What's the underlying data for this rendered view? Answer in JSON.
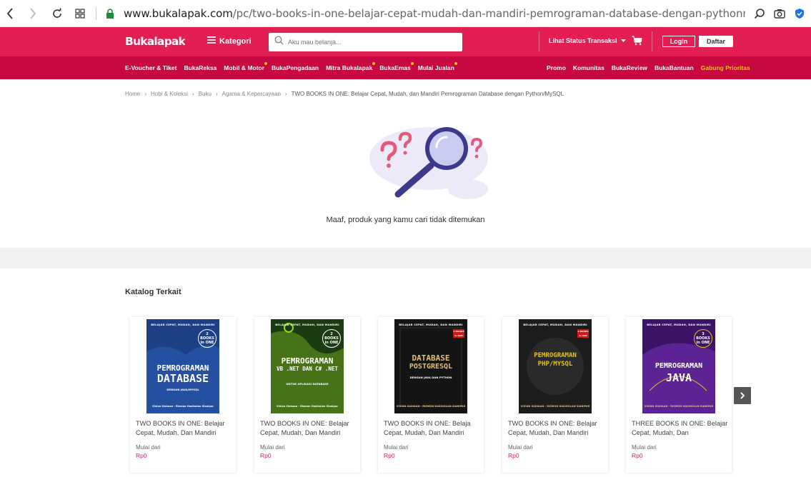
{
  "browser": {
    "url_host": "www.bukalapak.com",
    "url_path": "/pc/two-books-in-one-belajar-cepat-mudah-dan-mandiri-pemrograman-database-dengan-pythonmysql-vivian-siahaan"
  },
  "header": {
    "logo": "BUKALAPAK",
    "kategori_label": "Kategori",
    "search_placeholder": "Aku mau belanja...",
    "status_transaksi": "Lihat Status Transaksi",
    "login_label": "Login",
    "daftar_label": "Daftar"
  },
  "subnav_left": [
    {
      "label": "E-Voucher & Tiket",
      "dot": false
    },
    {
      "label": "BukaReksa",
      "dot": false
    },
    {
      "label": "Mobil & Motor",
      "dot": true
    },
    {
      "label": "BukaPengadaan",
      "dot": false
    },
    {
      "label": "Mitra Bukalapak",
      "dot": true
    },
    {
      "label": "BukaEmas",
      "dot": true
    },
    {
      "label": "Mulai Jualan",
      "dot": true
    }
  ],
  "subnav_right": [
    "Promo",
    "Komunitas",
    "BukaReview",
    "BukaBantuan",
    "Gabung Prioritas"
  ],
  "breadcrumb": [
    "Home",
    "Hobi & Koleksi",
    "Buku",
    "Agama & Kepercayaan",
    "TWO BOOKS IN ONE: Belajar Cepat, Mudah, dan Mandiri Pemrograman Database dengan Python/MySQL"
  ],
  "breadcrumb_sep": "›",
  "not_found_message": "Maaf, produk yang kamu cari tidak ditemukan",
  "katalog": {
    "title": "Katalog Terkait",
    "mulai_dari": "Mulai dari",
    "items": [
      {
        "name": "TWO BOOKS IN ONE: Belajar Cepat, Mudah, Dan Mandiri",
        "price": "Rp0",
        "cover": {
          "top": "BELAJAR CEPAT, MUDAH, DAN MANDIRI",
          "badge": "2 BOOKS in ONE",
          "title1": "PEMROGRAMAN",
          "title2": "DATABASE",
          "sub": "DENGAN JAVA/MYSQL",
          "author": "Vivian Siahaan - Rismon Hasiholan Sianipar",
          "bg": "#1d3f86"
        }
      },
      {
        "name": "TWO BOOKS IN ONE: Belajar Cepat, Mudah, Dan Mandiri",
        "price": "Rp0",
        "cover": {
          "top": "BELAJAR CEPAT, MUDAH, DAN MANDIRI",
          "badge": "2 BOOKS in ONE",
          "title1": "PEMROGRAMAN",
          "title2": "VB .NET DAN C# .NET",
          "sub": "UNTUK APLIKASI DATABASE",
          "author": "Vivian Siahaan - Rismon Hasiholan Sianipar",
          "bg": "#1f4a17"
        }
      },
      {
        "name": "TWO BOOKS IN ONE: Belaja Cepat, Mudah, Dan Mandiri",
        "price": "Rp0",
        "cover": {
          "top": "BELAJAR CEPAT, MUDAH, DAN MANDIRI",
          "badge": "2 BOOKS in ONE",
          "title1": "DATABASE",
          "title2": "POSTGRESQL",
          "sub": "DENGAN JAVA DAN PYTHON",
          "author": "VIVIAN SIAHAAN - RISMON HASIHOLAN SIANIPAR",
          "bg": "#151515"
        }
      },
      {
        "name": "TWO BOOKS IN ONE: Belajar Cepat, Mudah, Dan Mandiri",
        "price": "Rp0",
        "cover": {
          "top": "BELAJAR CEPAT, MUDAH, DAN MANDIRI",
          "badge": "2 BOOKS in ONE",
          "title1": "PEMROGRAMAN",
          "title2": "PHP/MYSQL",
          "sub": "",
          "author": "VIVIAN SIAHAAN - RISMON HASIHOLAN SIANIPAR",
          "bg": "#1a1a1a"
        }
      },
      {
        "name": "THREE BOOKS IN ONE: Belajar Cepat, Mudah, Dan",
        "price": "Rp0",
        "cover": {
          "top": "BELAJAR CEPAT, MUDAH, DAN MANDIRI",
          "badge": "3 BOOKS in ONE",
          "title1": "PEMROGRAMAN",
          "title2": "JAVA",
          "sub": "",
          "author": "VIVIAN SIAHAAN - RISMON HASIHOLAN SIANIPAR",
          "bg": "#3b1466"
        }
      }
    ]
  },
  "colors": {
    "brand": "#e31e52",
    "brand_dark": "#c7093f",
    "gold": "#ffc21a",
    "price": "#e31e52"
  }
}
